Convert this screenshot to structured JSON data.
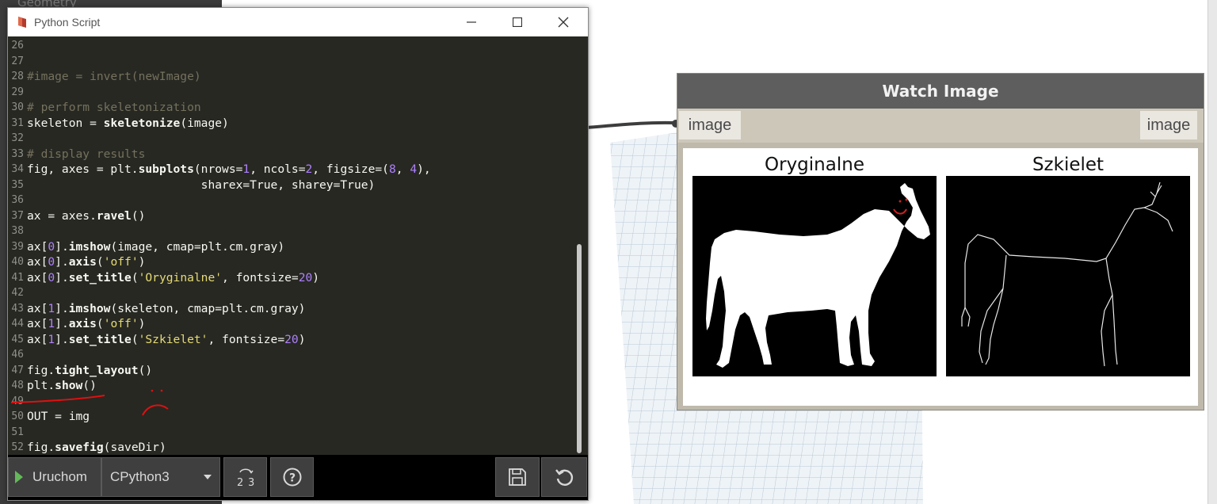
{
  "sidebar": {
    "hint": "Geometry"
  },
  "window": {
    "title": "Python Script"
  },
  "editor": {
    "lines": [
      {
        "n": "26",
        "html": ""
      },
      {
        "n": "27",
        "html": ""
      },
      {
        "n": "28",
        "html": "<span class=\"cm\">#image = invert(newImage)</span>"
      },
      {
        "n": "29",
        "html": ""
      },
      {
        "n": "30",
        "html": "<span class=\"cm\"># perform skeletonization</span>"
      },
      {
        "n": "31",
        "html": "skeleton = <span class=\"kw\">skeletonize</span>(image)"
      },
      {
        "n": "32",
        "html": ""
      },
      {
        "n": "33",
        "html": "<span class=\"cm\"># display results</span>"
      },
      {
        "n": "34",
        "html": "fig, axes = plt.<span class=\"kw\">subplots</span>(nrows=<span class=\"nm\">1</span>, ncols=<span class=\"nm\">2</span>, figsize=(<span class=\"nm\">8</span>, <span class=\"nm\">4</span>),"
      },
      {
        "n": "35",
        "html": "                         sharex=True, sharey=True)"
      },
      {
        "n": "36",
        "html": ""
      },
      {
        "n": "37",
        "html": "ax = axes.<span class=\"kw\">ravel</span>()"
      },
      {
        "n": "38",
        "html": ""
      },
      {
        "n": "39",
        "html": "ax[<span class=\"nm\">0</span>].<span class=\"kw\">imshow</span>(image, cmap=plt.cm.gray)"
      },
      {
        "n": "40",
        "html": "ax[<span class=\"nm\">0</span>].<span class=\"kw\">axis</span>(<span class=\"st\">'off'</span>)"
      },
      {
        "n": "41",
        "html": "ax[<span class=\"nm\">0</span>].<span class=\"kw\">set_title</span>(<span class=\"st\">'Oryginalne'</span>, fontsize=<span class=\"nm\">20</span>)"
      },
      {
        "n": "42",
        "html": ""
      },
      {
        "n": "43",
        "html": "ax[<span class=\"nm\">1</span>].<span class=\"kw\">imshow</span>(skeleton, cmap=plt.cm.gray)"
      },
      {
        "n": "44",
        "html": "ax[<span class=\"nm\">1</span>].<span class=\"kw\">axis</span>(<span class=\"st\">'off'</span>)"
      },
      {
        "n": "45",
        "html": "ax[<span class=\"nm\">1</span>].<span class=\"kw\">set_title</span>(<span class=\"st\">'Szkielet'</span>, fontsize=<span class=\"nm\">20</span>)"
      },
      {
        "n": "46",
        "html": ""
      },
      {
        "n": "47",
        "html": "fig.<span class=\"kw\">tight_layout</span>()"
      },
      {
        "n": "48",
        "html": "plt.<span class=\"kw\">show</span>()"
      },
      {
        "n": "49",
        "html": ""
      },
      {
        "n": "50",
        "html": "OUT = img"
      },
      {
        "n": "51",
        "html": ""
      },
      {
        "n": "52",
        "html": "fig.<span class=\"kw\">savefig</span>(saveDir)"
      }
    ]
  },
  "toolbar": {
    "run_label": "Uruchom",
    "engine_value": "CPython3",
    "convert_icon": "convert-2to3-icon",
    "help_icon": "help-icon",
    "save_icon": "save-icon",
    "revert_icon": "revert-icon"
  },
  "node": {
    "title": "Watch Image",
    "input_port": "image",
    "output_port": "image",
    "preview": {
      "left_title": "Oryginalne",
      "right_title": "Szkielet"
    }
  },
  "colors": {
    "editor_bg": "#272822",
    "node_header": "#5e5e5e",
    "annotation": "#e01010"
  }
}
